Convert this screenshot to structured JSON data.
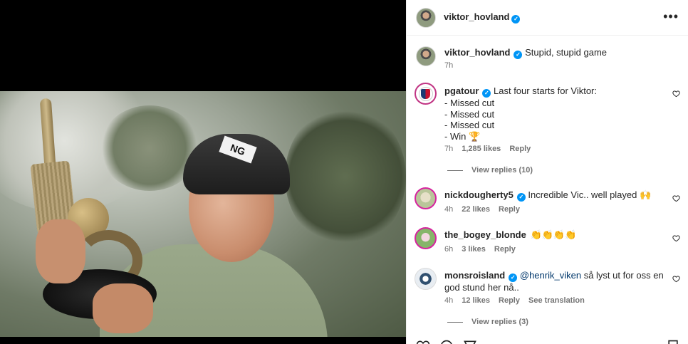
{
  "post": {
    "author": "viktor_hovland",
    "caption": "Stupid, stupid game",
    "caption_time": "7h",
    "photo_cap_text": "NG"
  },
  "comments": [
    {
      "username": "pgatour",
      "verified": true,
      "lines": [
        "Last four starts for Viktor:",
        "- Missed cut",
        "- Missed cut",
        "- Missed cut",
        "- Win 🏆"
      ],
      "time": "7h",
      "likes": "1,285 likes",
      "reply": "Reply",
      "view_replies": "View replies (10)"
    },
    {
      "username": "nickdougherty5",
      "verified": true,
      "text": "Incredible Vic.. well played 🙌",
      "time": "4h",
      "likes": "22 likes",
      "reply": "Reply"
    },
    {
      "username": "the_bogey_blonde",
      "verified": false,
      "text": "👏👏👏👏",
      "time": "6h",
      "likes": "3 likes",
      "reply": "Reply"
    },
    {
      "username": "monsroisland",
      "verified": true,
      "mention": "@henrik_viken",
      "text": "så lyst ut for oss en god stund her nå..",
      "time": "4h",
      "likes": "12 likes",
      "reply": "Reply",
      "translate": "See translation",
      "view_replies": "View replies (3)"
    }
  ],
  "icons": {
    "more": "more-options-icon",
    "verified": "verified-badge-icon",
    "heart": "heart-outline-icon"
  },
  "colors": {
    "verified": "#0095f6",
    "text": "#262626",
    "muted": "#737373",
    "mention": "#00376b"
  }
}
